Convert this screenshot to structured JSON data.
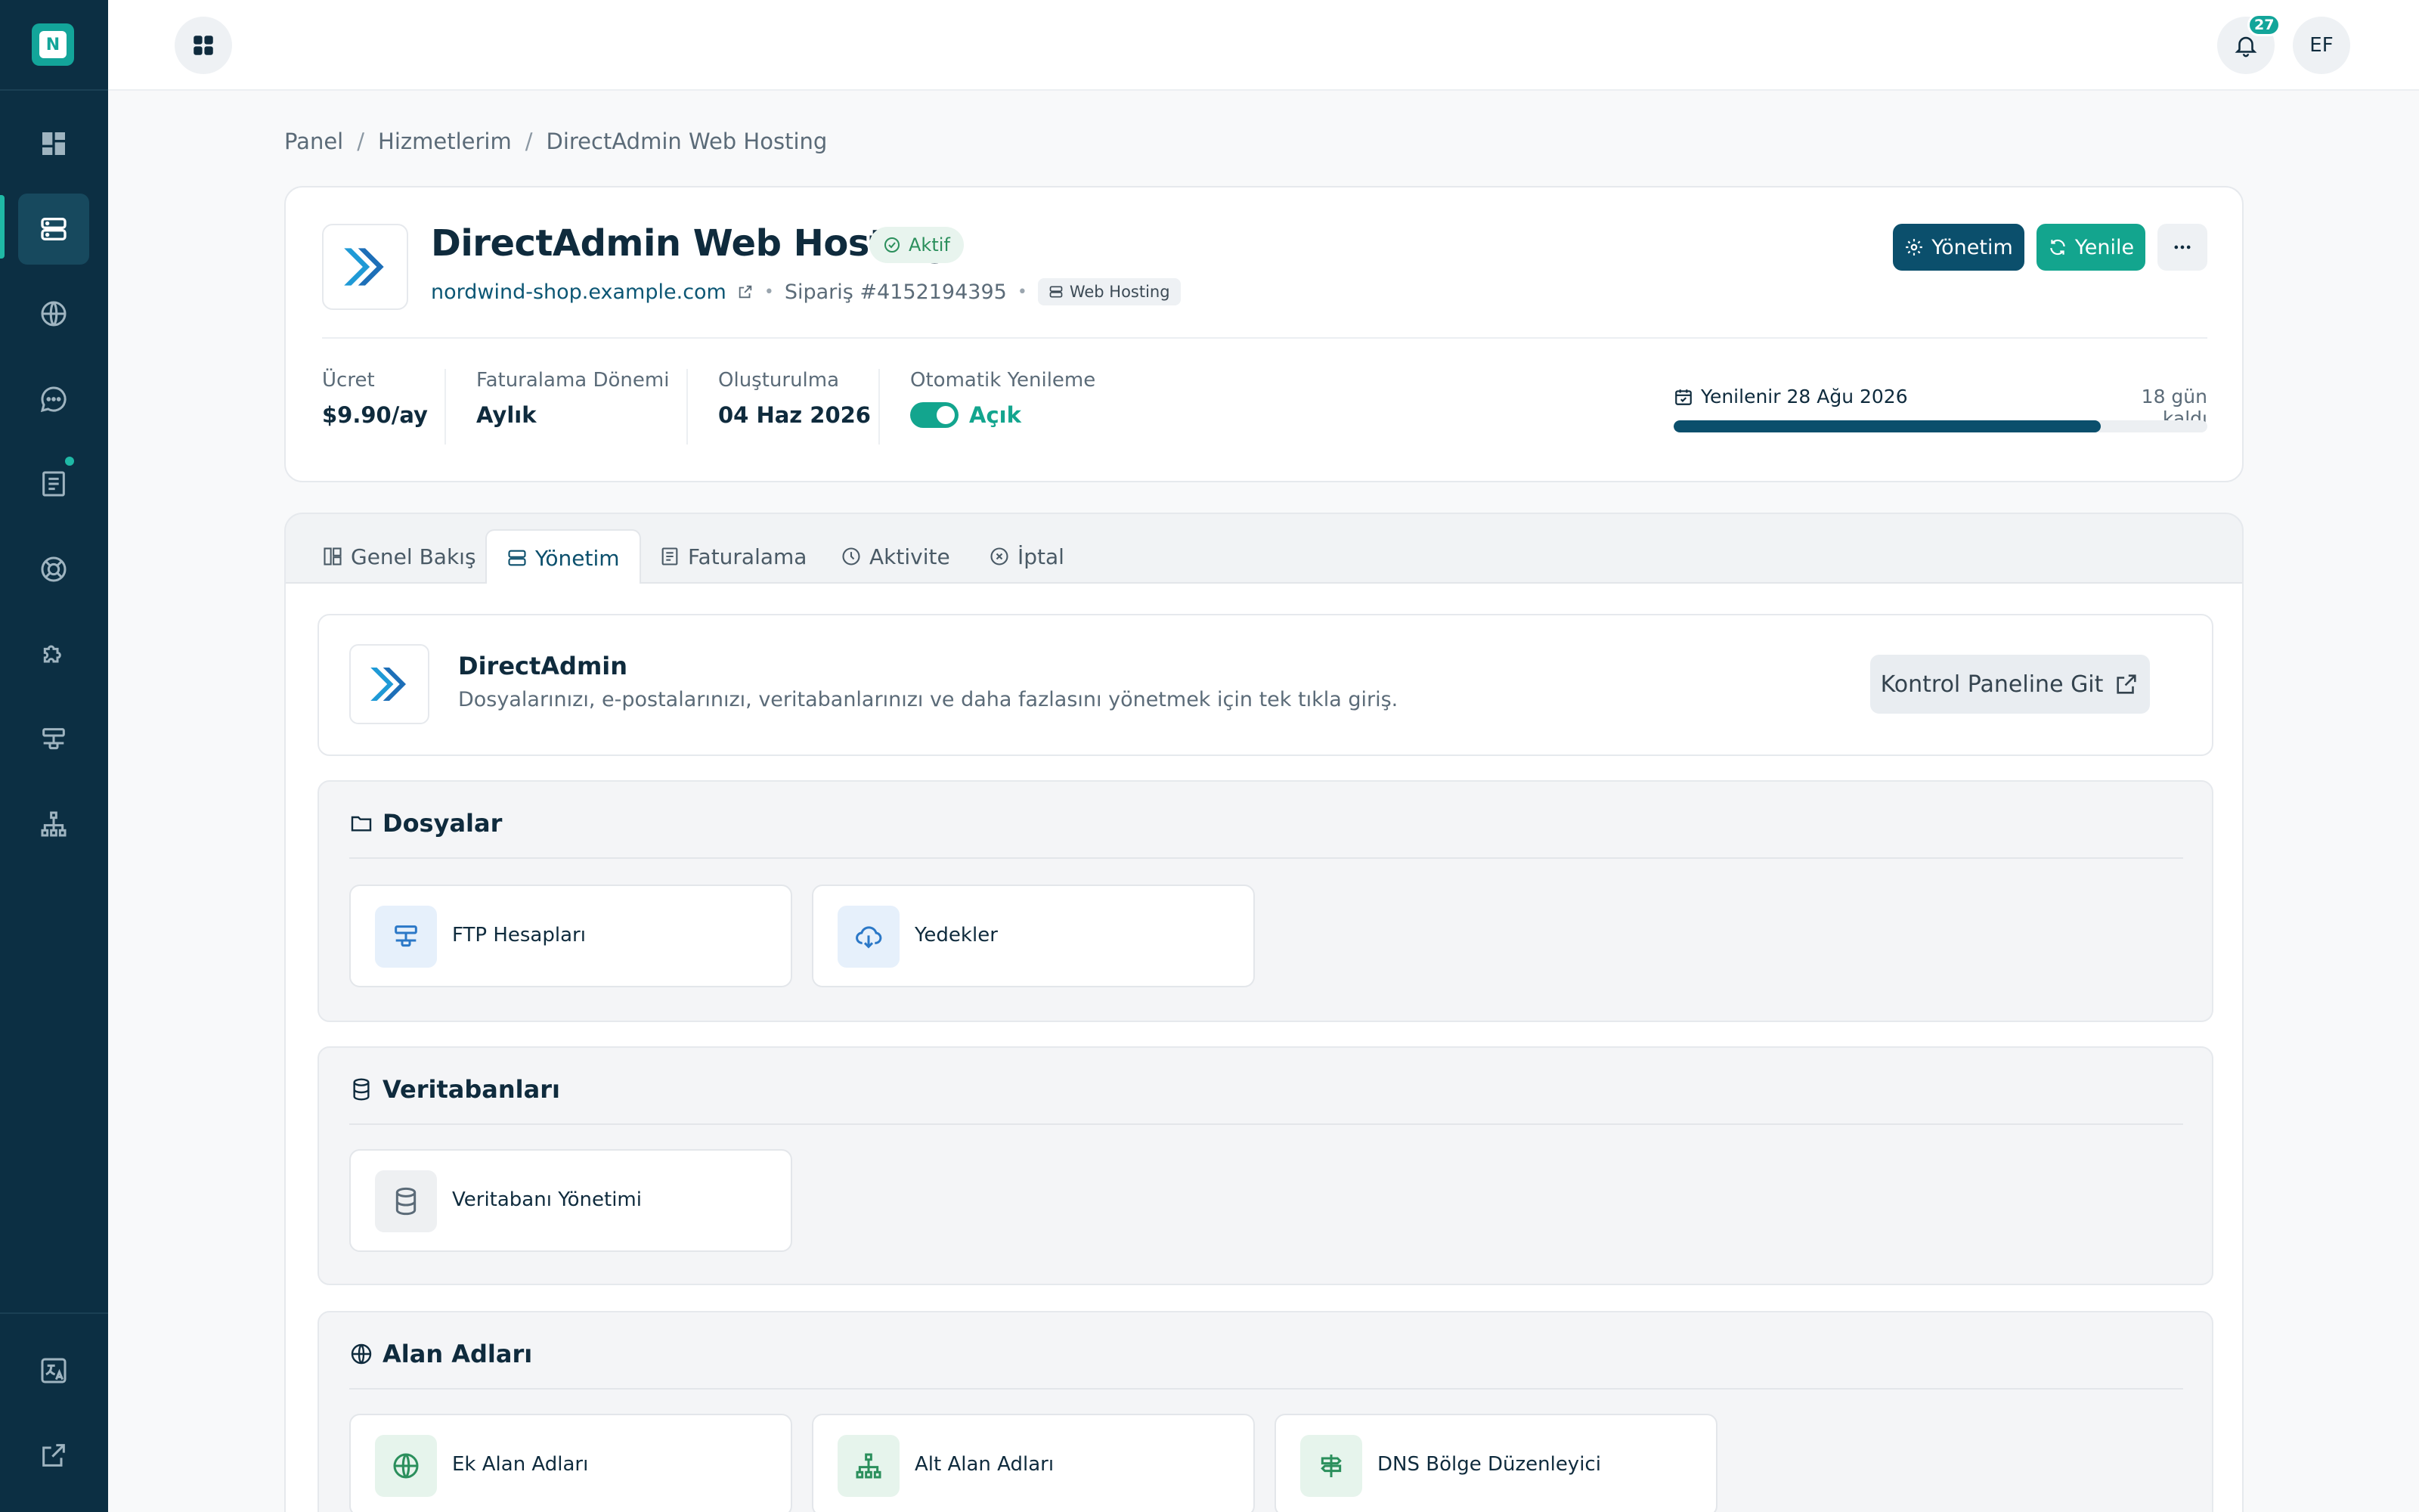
{
  "sidebar": {
    "logo_letter": "N",
    "items": [
      {
        "name": "dashboard"
      },
      {
        "name": "services",
        "active": true
      },
      {
        "name": "domains"
      },
      {
        "name": "support-chat"
      },
      {
        "name": "invoices",
        "notification": true
      },
      {
        "name": "help"
      },
      {
        "name": "addons"
      },
      {
        "name": "network"
      },
      {
        "name": "affiliates"
      }
    ],
    "bottom_items": [
      {
        "name": "language"
      },
      {
        "name": "external-link"
      }
    ]
  },
  "topbar": {
    "notifications_count": "27",
    "avatar_initials": "EF"
  },
  "breadcrumb": [
    "Panel",
    "Hizmetlerim",
    "DirectAdmin Web Hosting"
  ],
  "service": {
    "title": "DirectAdmin Web Hosting",
    "status": "Aktif",
    "domain": "nordwind-shop.example.com",
    "order": "Sipariş #4152194395",
    "category": "Web Hosting",
    "buttons": {
      "manage": "Yönetim",
      "renew": "Yenile"
    },
    "stats": [
      {
        "label": "Ücret",
        "value": "$9.90/ay"
      },
      {
        "label": "Faturalama Dönemi",
        "value": "Aylık"
      },
      {
        "label": "Oluşturulma",
        "value": "04 Haz 2026"
      },
      {
        "label": "Otomatik Yenileme",
        "value": "Açık"
      }
    ],
    "renewal": {
      "text": "Yenilenir 28 Ağu 2026",
      "remaining": "18 gün kaldı",
      "progress": 0.8
    }
  },
  "tabs": [
    {
      "label": "Genel Bakış"
    },
    {
      "label": "Yönetim",
      "active": true
    },
    {
      "label": "Faturalama"
    },
    {
      "label": "Aktivite"
    },
    {
      "label": "İptal"
    }
  ],
  "panel": {
    "title": "DirectAdmin",
    "description": "Dosyalarınızı, e-postalarınızı, veritabanlarınızı ve daha fazlasını yönetmek için tek tıkla giriş.",
    "button": "Kontrol Paneline Git"
  },
  "sections": [
    {
      "title": "Dosyalar",
      "tiles": [
        {
          "label": "FTP Hesapları",
          "icon": "ftp-icon"
        },
        {
          "label": "Yedekler",
          "icon": "cloud-download-icon"
        }
      ]
    },
    {
      "title": "Veritabanları",
      "tiles": [
        {
          "label": "Veritabanı Yönetimi",
          "icon": "database-icon"
        }
      ]
    },
    {
      "title": "Alan Adları",
      "tiles": [
        {
          "label": "Ek Alan Adları",
          "icon": "globe-icon"
        },
        {
          "label": "Alt Alan Adları",
          "icon": "sitemap-icon"
        },
        {
          "label": "DNS Bölge Düzenleyici",
          "icon": "signpost-icon"
        }
      ]
    }
  ],
  "colors": {
    "sidebar": "#0c2f43",
    "primary": "#0b4f6c",
    "accent": "#13a58e",
    "success_bg": "#e8f4ee"
  }
}
